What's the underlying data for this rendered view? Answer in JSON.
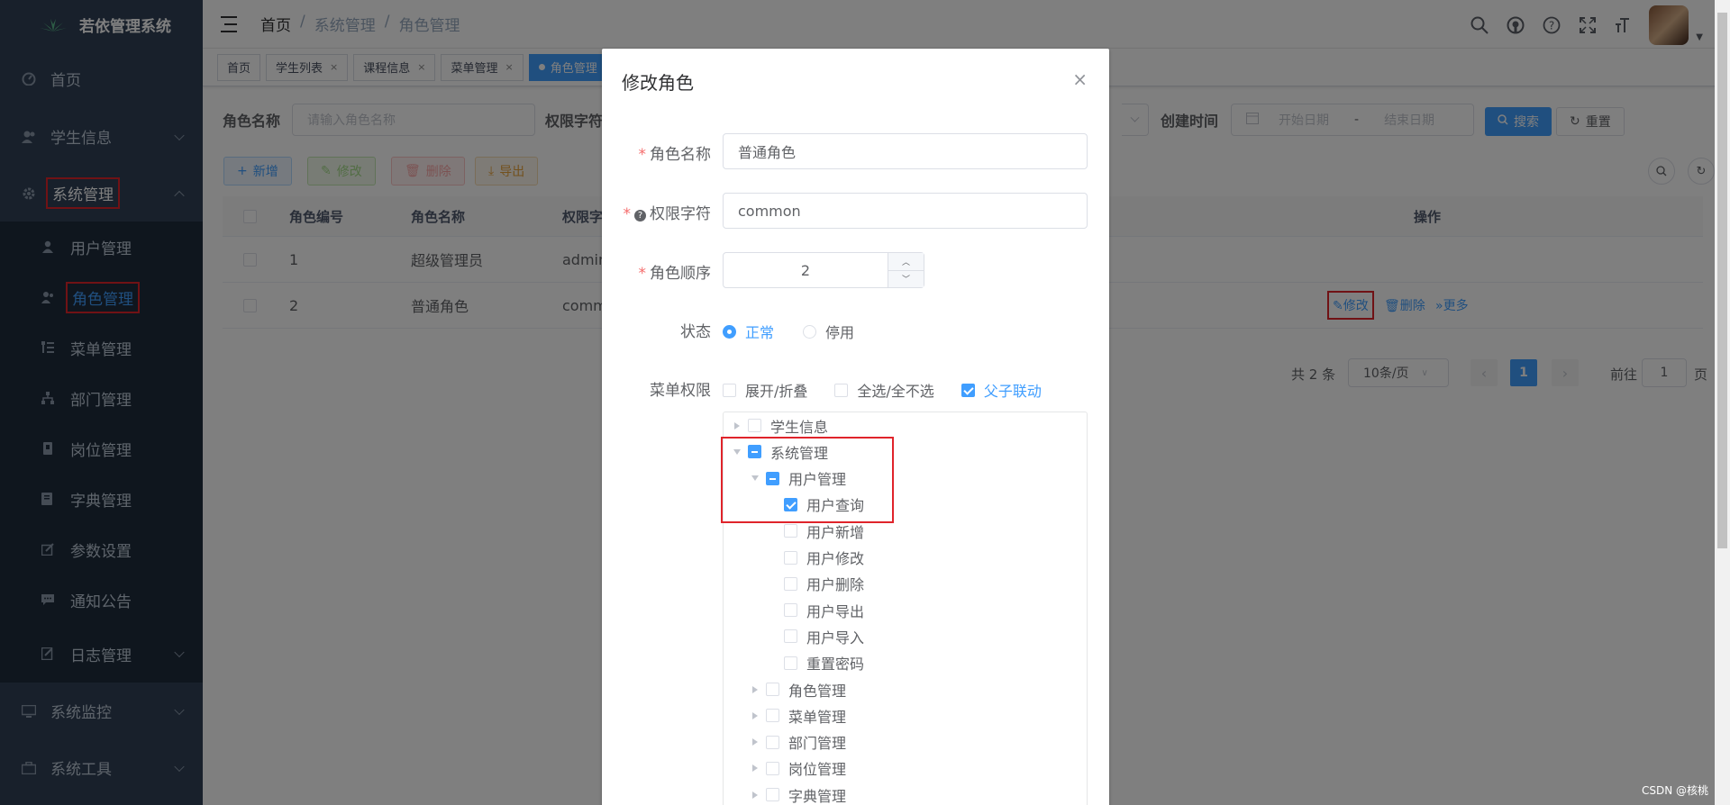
{
  "app": {
    "title": "若依管理系统"
  },
  "sidebar": {
    "items": [
      {
        "label": "首页",
        "icon": "dashboard-icon"
      },
      {
        "label": "学生信息",
        "icon": "user-group-icon"
      },
      {
        "label": "系统管理",
        "icon": "gear-icon"
      }
    ],
    "system_sub": [
      {
        "label": "用户管理",
        "icon": "user-icon"
      },
      {
        "label": "角色管理",
        "icon": "role-icon"
      },
      {
        "label": "菜单管理",
        "icon": "menu-tree-icon"
      },
      {
        "label": "部门管理",
        "icon": "org-icon"
      },
      {
        "label": "岗位管理",
        "icon": "post-icon"
      },
      {
        "label": "字典管理",
        "icon": "dict-icon"
      },
      {
        "label": "参数设置",
        "icon": "edit-icon"
      },
      {
        "label": "通知公告",
        "icon": "message-icon"
      },
      {
        "label": "日志管理",
        "icon": "log-icon"
      }
    ],
    "bottom": [
      {
        "label": "系统监控",
        "icon": "monitor-icon"
      },
      {
        "label": "系统工具",
        "icon": "toolbox-icon"
      }
    ]
  },
  "breadcrumb": [
    "首页",
    "/",
    "系统管理",
    "/",
    "角色管理"
  ],
  "tags": [
    {
      "label": "首页"
    },
    {
      "label": "学生列表"
    },
    {
      "label": "课程信息"
    },
    {
      "label": "菜单管理"
    },
    {
      "label": "角色管理"
    }
  ],
  "search": {
    "role_name_label": "角色名称",
    "role_name_placeholder": "请输入角色名称",
    "perm_label": "权限字符",
    "created_label": "创建时间",
    "start_placeholder": "开始日期",
    "range_sep": "-",
    "end_placeholder": "结束日期",
    "search_btn": "搜索",
    "reset_btn": "重置"
  },
  "toolbar": {
    "add": "新增",
    "edit": "修改",
    "delete": "删除",
    "export": "导出"
  },
  "table": {
    "headers": [
      "角色编号",
      "角色名称",
      "权限字",
      "操作"
    ],
    "rows": [
      {
        "id": "1",
        "name": "超级管理员",
        "perm": "admin"
      },
      {
        "id": "2",
        "name": "普通角色",
        "perm": "comm"
      }
    ],
    "actions": {
      "edit": "修改",
      "delete": "删除",
      "more": "更多"
    }
  },
  "pagination": {
    "total": "共 2 条",
    "size": "10条/页",
    "page": "1",
    "goto": "前往",
    "goto_val": "1",
    "page_unit": "页"
  },
  "dialog": {
    "title": "修改角色",
    "close": "×",
    "fields": {
      "role_name_label": "角色名称",
      "role_name_value": "普通角色",
      "perm_label": "权限字符",
      "perm_value": "common",
      "order_label": "角色顺序",
      "order_value": "2",
      "status_label": "状态",
      "status_normal": "正常",
      "status_disabled": "停用",
      "menu_perm_label": "菜单权限",
      "expand": "展开/折叠",
      "select_all": "全选/全不选",
      "linkage": "父子联动"
    },
    "tree": [
      {
        "label": "学生信息",
        "level": 0,
        "state": "none",
        "arrow": "right"
      },
      {
        "label": "系统管理",
        "level": 0,
        "state": "indet",
        "arrow": "down"
      },
      {
        "label": "用户管理",
        "level": 1,
        "state": "indet",
        "arrow": "down"
      },
      {
        "label": "用户查询",
        "level": 2,
        "state": "checked",
        "arrow": "none"
      },
      {
        "label": "用户新增",
        "level": 2,
        "state": "none",
        "arrow": "none"
      },
      {
        "label": "用户修改",
        "level": 2,
        "state": "none",
        "arrow": "none"
      },
      {
        "label": "用户删除",
        "level": 2,
        "state": "none",
        "arrow": "none"
      },
      {
        "label": "用户导出",
        "level": 2,
        "state": "none",
        "arrow": "none"
      },
      {
        "label": "用户导入",
        "level": 2,
        "state": "none",
        "arrow": "none"
      },
      {
        "label": "重置密码",
        "level": 2,
        "state": "none",
        "arrow": "none"
      },
      {
        "label": "角色管理",
        "level": 1,
        "state": "none",
        "arrow": "right"
      },
      {
        "label": "菜单管理",
        "level": 1,
        "state": "none",
        "arrow": "right"
      },
      {
        "label": "部门管理",
        "level": 1,
        "state": "none",
        "arrow": "right"
      },
      {
        "label": "岗位管理",
        "level": 1,
        "state": "none",
        "arrow": "right"
      },
      {
        "label": "字典管理",
        "level": 1,
        "state": "none",
        "arrow": "right"
      }
    ]
  },
  "watermark": "CSDN @核桃",
  "colors": {
    "sidebar": "#304156",
    "submenu": "#1f2d3d",
    "primary": "#409eff",
    "annotation": "#e0242b"
  }
}
